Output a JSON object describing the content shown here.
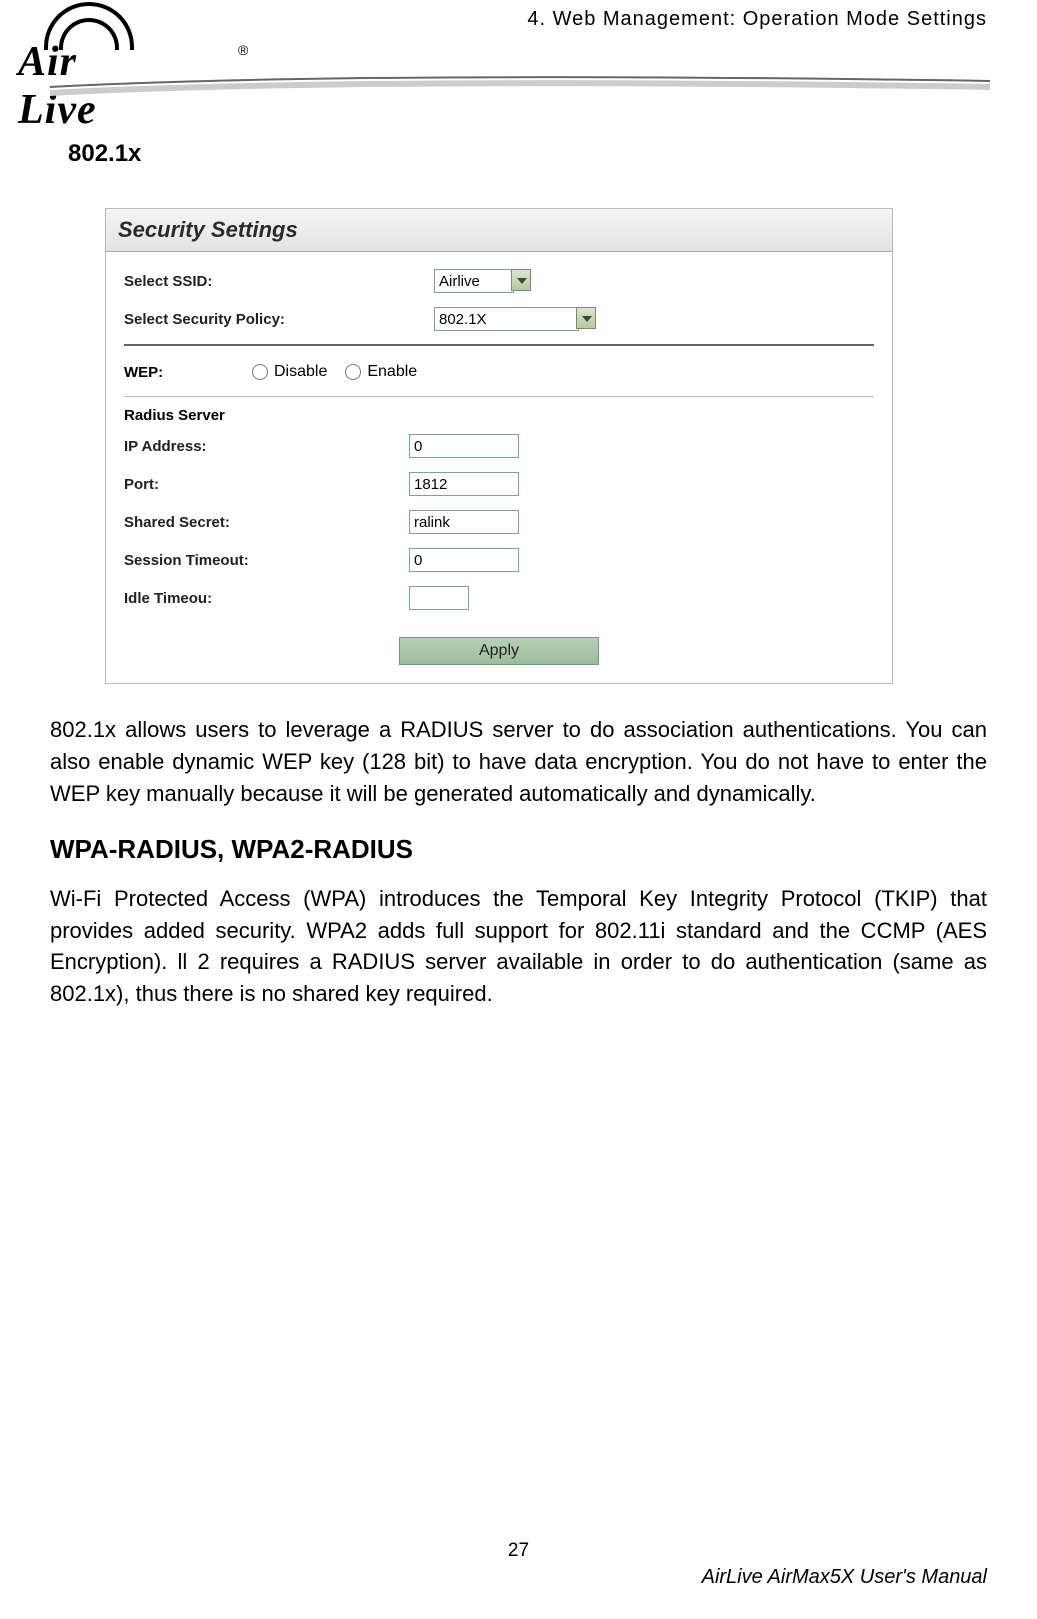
{
  "header": {
    "chapter": "4. Web Management: Operation Mode Settings",
    "logo_text": "Air Live",
    "trademark": "®"
  },
  "section": {
    "title_1": "802.1x",
    "paragraph_1": "802.1x allows users to leverage a RADIUS server to do association authentications. You can also enable dynamic WEP key (128 bit) to have data encryption. You do not have to enter the WEP key manually because it will be generated automatically and dynamically.",
    "title_2": "WPA-RADIUS, WPA2-RADIUS",
    "paragraph_2": "Wi-Fi Protected Access (WPA) introduces the Temporal Key Integrity Protocol (TKIP) that provides added security. WPA2 adds full support for 802.11i standard and the CCMP (AES Encryption). ll 2 requires a RADIUS server available in order to do authentication (same as 802.1x), thus there is no shared key required."
  },
  "screenshot": {
    "panel_title": "Security Settings",
    "select_ssid_label": "Select SSID:",
    "select_ssid_value": "Airlive",
    "select_policy_label": "Select Security Policy:",
    "select_policy_value": "802.1X",
    "wep_label": "WEP:",
    "wep_disable": "Disable",
    "wep_enable": "Enable",
    "radius_header": "Radius Server",
    "ip_label": "IP Address:",
    "ip_value": "0",
    "port_label": "Port:",
    "port_value": "1812",
    "secret_label": "Shared Secret:",
    "secret_value": "ralink",
    "session_label": "Session Timeout:",
    "session_value": "0",
    "idle_label": "Idle Timeou:",
    "idle_value": "",
    "apply_label": "Apply"
  },
  "footer": {
    "page_number": "27",
    "manual_title": "AirLive AirMax5X User's Manual"
  }
}
